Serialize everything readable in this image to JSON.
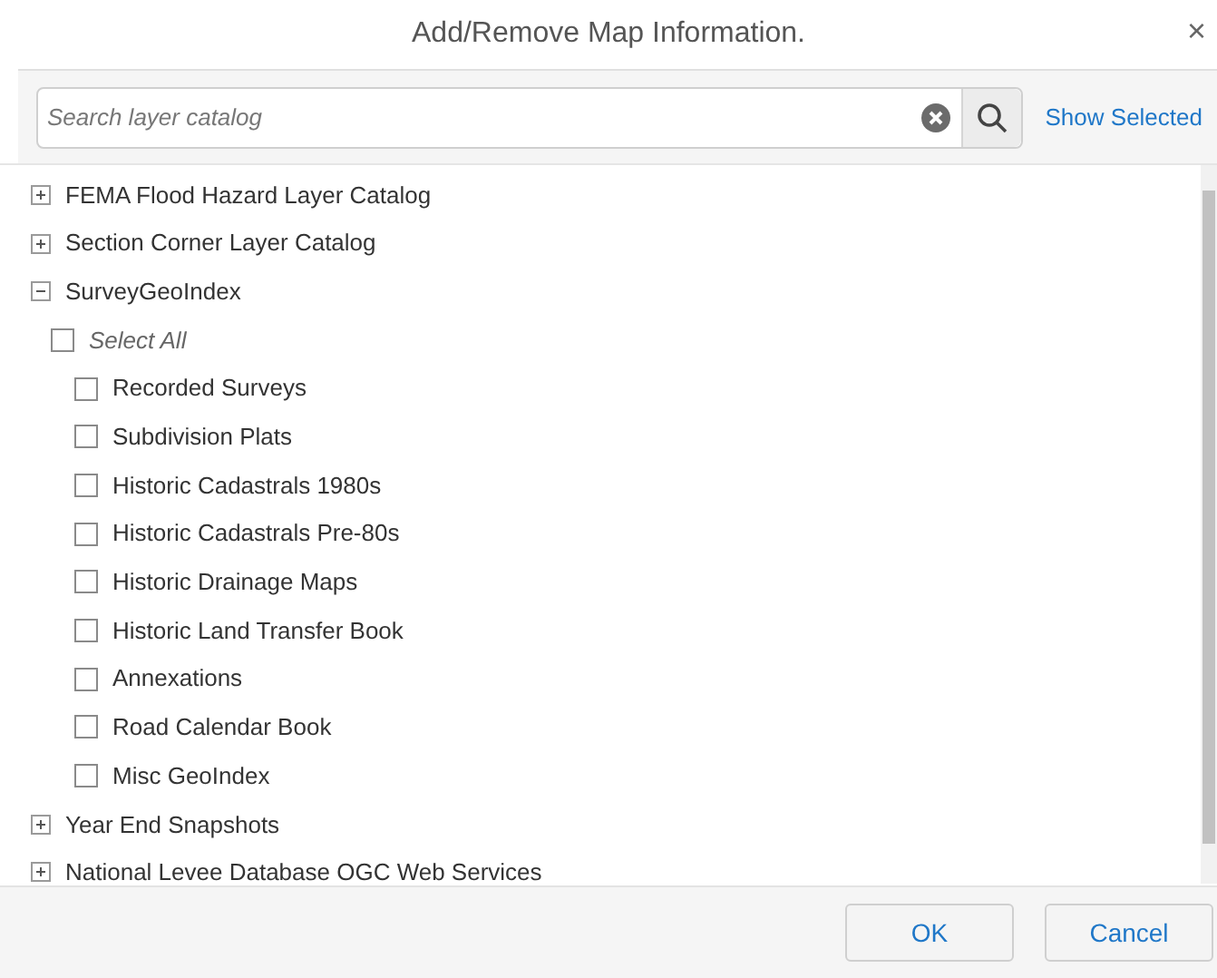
{
  "dialog": {
    "title": "Add/Remove Map Information.",
    "close": "×"
  },
  "search": {
    "placeholder": "Search layer catalog"
  },
  "show_selected": "Show Selected",
  "catalog": [
    {
      "label": "FEMA Flood Hazard Layer Catalog",
      "expanded": false
    },
    {
      "label": "Section Corner Layer Catalog",
      "expanded": false
    },
    {
      "label": "SurveyGeoIndex",
      "expanded": true,
      "select_all": {
        "label": "Select All",
        "checked": false
      },
      "children": [
        {
          "label": "Recorded Surveys",
          "checked": false
        },
        {
          "label": "Subdivision Plats",
          "checked": false
        },
        {
          "label": "Historic Cadastrals 1980s",
          "checked": false
        },
        {
          "label": "Historic Cadastrals Pre-80s",
          "checked": false
        },
        {
          "label": "Historic Drainage Maps",
          "checked": false
        },
        {
          "label": "Historic Land Transfer Book",
          "checked": false
        },
        {
          "label": "Annexations",
          "checked": false
        },
        {
          "label": "Road Calendar Book",
          "checked": false
        },
        {
          "label": "Misc GeoIndex",
          "checked": false
        }
      ]
    },
    {
      "label": "Year End Snapshots",
      "expanded": false
    },
    {
      "label": "National Levee Database OGC Web Services",
      "expanded": false
    }
  ],
  "buttons": [
    "OK",
    "Cancel"
  ]
}
